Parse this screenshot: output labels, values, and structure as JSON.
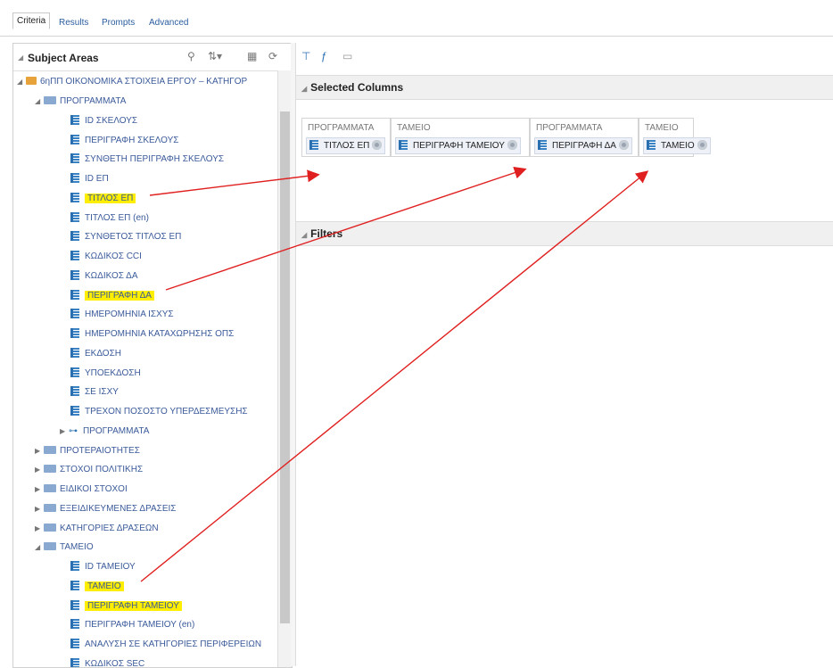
{
  "tabs": [
    "Criteria",
    "Results",
    "Prompts",
    "Advanced"
  ],
  "subject_panel": {
    "title": "Subject Areas",
    "root": "6ηΠΠ ΟΙΚΟΝΟΜΙΚΑ ΣΤΟΙΧΕΙΑ ΕΡΓΟΥ – ΚΑΤΗΓΟΡ",
    "tree": [
      {
        "label": "ΠΡΟΓΡΑΜΜΑΤΑ",
        "type": "folder",
        "level": 1,
        "expanded": true
      },
      {
        "label": "ID ΣΚΕΛΟΥΣ",
        "type": "column",
        "level": 2
      },
      {
        "label": "ΠΕΡΙΓΡΑΦΗ ΣΚΕΛΟΥΣ",
        "type": "column",
        "level": 2
      },
      {
        "label": "ΣΥΝΘΕΤΗ ΠΕΡΙΓΡΑΦΗ ΣΚΕΛΟΥΣ",
        "type": "column",
        "level": 2
      },
      {
        "label": "ID ΕΠ",
        "type": "column",
        "level": 2
      },
      {
        "label": "ΤΙΤΛΟΣ ΕΠ",
        "type": "column",
        "level": 2,
        "highlight": true
      },
      {
        "label": "ΤΙΤΛΟΣ ΕΠ (en)",
        "type": "column",
        "level": 2
      },
      {
        "label": "ΣΥΝΘΕΤΟΣ ΤΙΤΛΟΣ ΕΠ",
        "type": "column",
        "level": 2
      },
      {
        "label": "ΚΩΔΙΚΟΣ CCI",
        "type": "column",
        "level": 2
      },
      {
        "label": "ΚΩΔΙΚΟΣ ΔΑ",
        "type": "column",
        "level": 2
      },
      {
        "label": "ΠΕΡΙΓΡΑΦΗ ΔΑ",
        "type": "column",
        "level": 2,
        "highlight": true
      },
      {
        "label": "ΗΜΕΡΟΜΗΝΙΑ ΙΣΧΥΣ",
        "type": "column",
        "level": 2
      },
      {
        "label": "ΗΜΕΡΟΜΗΝΙΑ ΚΑΤΑΧΩΡΗΣΗΣ ΟΠΣ",
        "type": "column",
        "level": 2
      },
      {
        "label": "ΕΚΔΟΣΗ",
        "type": "column",
        "level": 2
      },
      {
        "label": "ΥΠΟΕΚΔΟΣΗ",
        "type": "column",
        "level": 2
      },
      {
        "label": "ΣΕ ΙΣΧΥ",
        "type": "column",
        "level": 2
      },
      {
        "label": "ΤΡΕΧΟΝ ΠΟΣΟΣΤΟ ΥΠΕΡΔΕΣΜΕΥΣΗΣ",
        "type": "column",
        "level": 2
      },
      {
        "label": "ΠΡΟΓΡΑΜΜΑΤΑ",
        "type": "hierarchy",
        "level": 2,
        "expanded": false
      },
      {
        "label": "ΠΡΟΤΕΡΑΙΟΤΗΤΕΣ",
        "type": "folder",
        "level": 1,
        "expanded": false
      },
      {
        "label": "ΣΤΟΧΟΙ ΠΟΛΙΤΙΚΗΣ",
        "type": "folder",
        "level": 1,
        "expanded": false
      },
      {
        "label": "ΕΙΔΙΚΟΙ ΣΤΟΧΟΙ",
        "type": "folder",
        "level": 1,
        "expanded": false
      },
      {
        "label": "ΕΞΕΙΔΙΚΕΥΜΕΝΕΣ ΔΡΑΣΕΙΣ",
        "type": "folder",
        "level": 1,
        "expanded": false
      },
      {
        "label": "ΚΑΤΗΓΟΡΙΕΣ ΔΡΑΣΕΩΝ",
        "type": "folder",
        "level": 1,
        "expanded": false
      },
      {
        "label": "ΤΑΜΕΙΟ",
        "type": "folder",
        "level": 1,
        "expanded": true
      },
      {
        "label": "ID ΤΑΜΕΙΟΥ",
        "type": "column",
        "level": 2
      },
      {
        "label": "ΤΑΜΕΙΟ",
        "type": "column",
        "level": 2,
        "highlight": true
      },
      {
        "label": "ΠΕΡΙΓΡΑΦΗ ΤΑΜΕΙΟΥ",
        "type": "column",
        "level": 2,
        "highlight": true
      },
      {
        "label": "ΠΕΡΙΓΡΑΦΗ ΤΑΜΕΙΟΥ (en)",
        "type": "column",
        "level": 2
      },
      {
        "label": "ΑΝΑΛΥΣΗ ΣΕ ΚΑΤΗΓΟΡΙΕΣ ΠΕΡΙΦΕΡΕΙΩΝ",
        "type": "column",
        "level": 2
      },
      {
        "label": "ΚΩΔΙΚΟΣ SEC",
        "type": "column",
        "level": 2
      }
    ]
  },
  "selected_columns": {
    "title": "Selected Columns",
    "columns": [
      {
        "folder": "ΠΡΟΓΡΑΜΜΑΤΑ",
        "name": "ΤΙΤΛΟΣ ΕΠ"
      },
      {
        "folder": "ΤΑΜΕΙΟ",
        "name": "ΠΕΡΙΓΡΑΦΗ ΤΑΜΕΙΟΥ"
      },
      {
        "folder": "ΠΡΟΓΡΑΜΜΑΤΑ",
        "name": "ΠΕΡΙΓΡΑΦΗ ΔΑ"
      },
      {
        "folder": "ΤΑΜΕΙΟ",
        "name": "ΤΑΜΕΙΟ"
      }
    ]
  },
  "filters": {
    "title": "Filters"
  },
  "colors": {
    "highlight": "#ffee00",
    "arrow": "#e02020",
    "link": "#2a5d9f"
  }
}
